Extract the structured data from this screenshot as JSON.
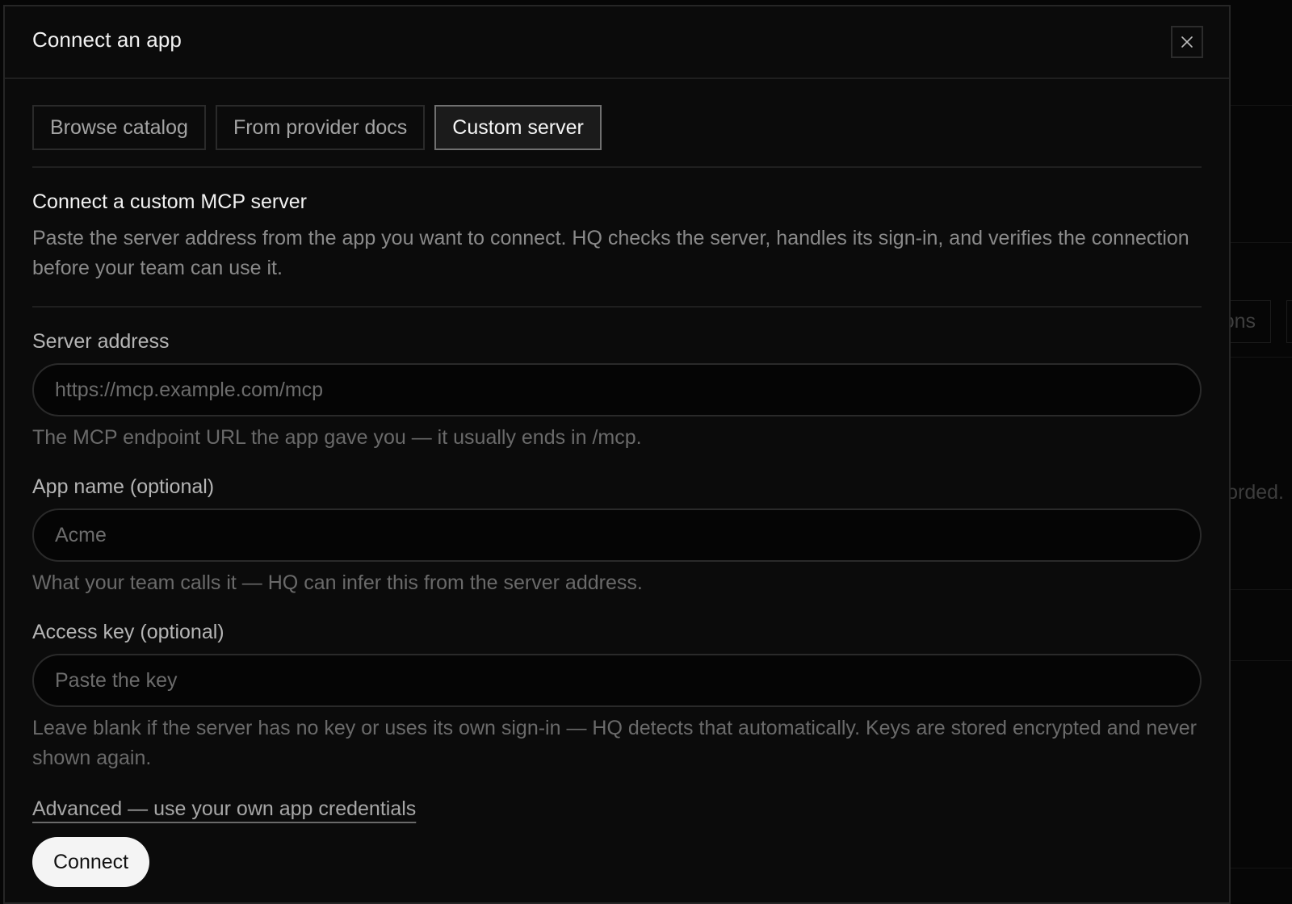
{
  "background": {
    "tab_fragment": "ons",
    "text_fragment": "orded."
  },
  "modal": {
    "title": "Connect an app",
    "close_icon": "close-icon",
    "tabs": [
      {
        "label": "Browse catalog",
        "active": false
      },
      {
        "label": "From provider docs",
        "active": false
      },
      {
        "label": "Custom server",
        "active": true
      }
    ],
    "section": {
      "title": "Connect a custom MCP server",
      "description": "Paste the server address from the app you want to connect. HQ checks the server, handles its sign-in, and verifies the connection before your team can use it."
    },
    "fields": {
      "server_address": {
        "label": "Server address",
        "placeholder": "https://mcp.example.com/mcp",
        "value": "",
        "hint": "The MCP endpoint URL the app gave you — it usually ends in /mcp."
      },
      "app_name": {
        "label": "App name (optional)",
        "placeholder": "Acme",
        "value": "",
        "hint": "What your team calls it — HQ can infer this from the server address."
      },
      "access_key": {
        "label": "Access key (optional)",
        "placeholder": "Paste the key",
        "value": "",
        "hint": "Leave blank if the server has no key or uses its own sign-in — HQ detects that automatically. Keys are stored encrypted and never shown again."
      }
    },
    "advanced_link": "Advanced — use your own app credentials",
    "connect_label": "Connect"
  }
}
